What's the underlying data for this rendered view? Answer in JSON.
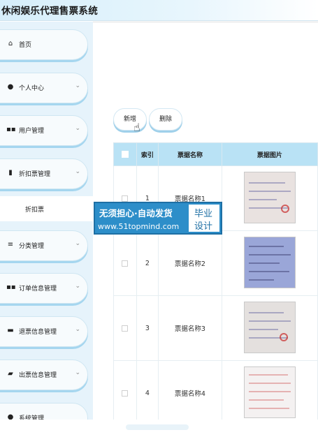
{
  "app": {
    "title": "休闲娱乐代理售票系统"
  },
  "sidebar": {
    "items": [
      {
        "label": "首页",
        "icon": "home-icon",
        "chevron": ""
      },
      {
        "label": "个人中心",
        "icon": "user-icon",
        "chevron": "⌄"
      },
      {
        "label": "用户管理",
        "icon": "grid-icon",
        "chevron": "⌄"
      },
      {
        "label": "折扣票管理",
        "icon": "chart-icon",
        "chevron": "⌄"
      },
      {
        "label": "分类管理",
        "icon": "list-icon",
        "chevron": "⌄"
      },
      {
        "label": "订单信息管理",
        "icon": "grid-icon",
        "chevron": "⌄"
      },
      {
        "label": "退票信息管理",
        "icon": "monitor-icon",
        "chevron": "⌄"
      },
      {
        "label": "出票信息管理",
        "icon": "printer-icon",
        "chevron": "⌄"
      },
      {
        "label": "系统管理",
        "icon": "settings-icon",
        "chevron": ""
      }
    ],
    "sub_item": {
      "label": "折扣票"
    }
  },
  "toolbar": {
    "add_label": "新增",
    "delete_label": "删除"
  },
  "table": {
    "columns": [
      "索引",
      "票据名称",
      "票据图片"
    ],
    "rows": [
      {
        "index": "1",
        "name": "票据名称1"
      },
      {
        "index": "2",
        "name": "票据名称2"
      },
      {
        "index": "3",
        "name": "票据名称3"
      },
      {
        "index": "4",
        "name": "票据名称4"
      }
    ]
  },
  "watermark": {
    "line1": "无须担心·自动发货",
    "line2": "www.51topmind.com",
    "right1": "毕业",
    "right2": "设计"
  },
  "colors": {
    "accent": "#b9e2f5",
    "sidebar_bg": "#e6f3fb",
    "button_shadow": "#9fd0ea",
    "watermark_bg": "#2d8ec9"
  }
}
